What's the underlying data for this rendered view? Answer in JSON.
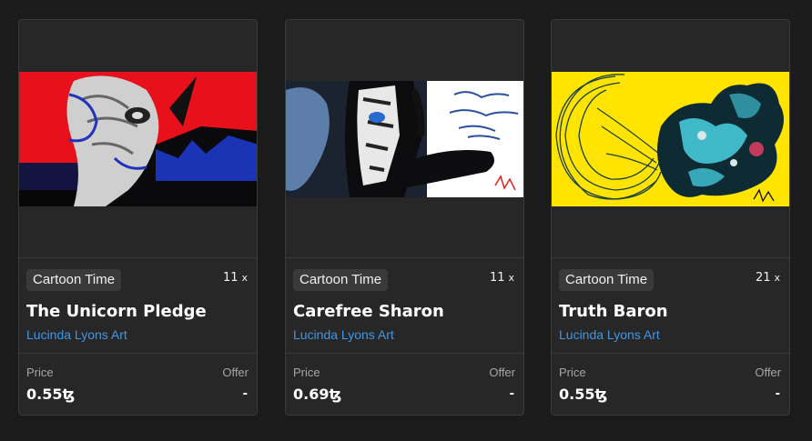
{
  "cards": [
    {
      "tag": "Cartoon Time",
      "count": "11",
      "count_suffix": "x",
      "title": "The Unicorn Pledge",
      "creator": "Lucinda Lyons Art",
      "price_label": "Price",
      "price": "0.55ꜩ",
      "offer_label": "Offer",
      "offer": "-"
    },
    {
      "tag": "Cartoon Time",
      "count": "11",
      "count_suffix": "x",
      "title": "Carefree Sharon",
      "creator": "Lucinda Lyons Art",
      "price_label": "Price",
      "price": "0.69ꜩ",
      "offer_label": "Offer",
      "offer": "-"
    },
    {
      "tag": "Cartoon Time",
      "count": "21",
      "count_suffix": "x",
      "title": "Truth Baron",
      "creator": "Lucinda Lyons Art",
      "price_label": "Price",
      "price": "0.55ꜩ",
      "offer_label": "Offer",
      "offer": "-"
    }
  ],
  "colors": {
    "background": "#1b1b1b",
    "card": "#272727",
    "border": "#3a3a3a",
    "tag_bg": "#3a3a3a",
    "link": "#3f97e6",
    "muted": "#a6a6a6"
  }
}
